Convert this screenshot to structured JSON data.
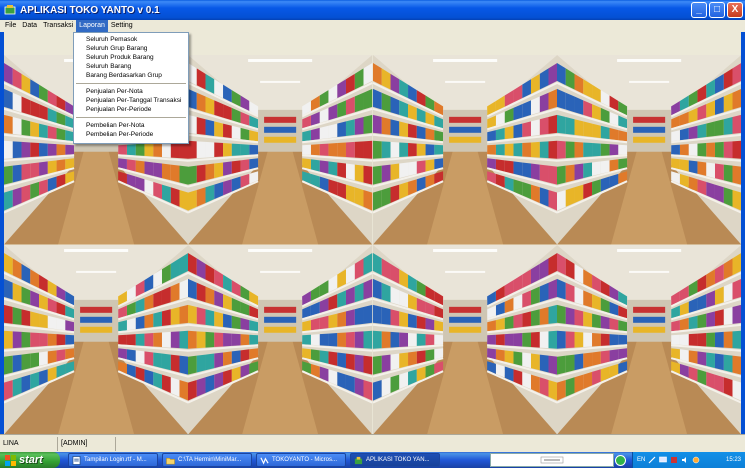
{
  "window": {
    "title": "APLIKASI TOKO YANTO v 0.1",
    "buttons": {
      "minimize": "_",
      "maximize": "□",
      "close": "X"
    }
  },
  "menubar": {
    "items": [
      {
        "label": "File"
      },
      {
        "label": "Data"
      },
      {
        "label": "Transaksi"
      },
      {
        "label": "Laporan"
      },
      {
        "label": "Setting"
      }
    ],
    "active": "Laporan"
  },
  "dropdown": {
    "groups": [
      [
        "Seluruh Pemasok",
        "Seluruh Grup Barang",
        "Seluruh Produk Barang",
        "Seluruh Barang",
        "Barang Berdasarkan Grup"
      ],
      [
        "Penjualan Per-Nota",
        "Penjualan Per-Tanggal Transaksi",
        "Penjualan Per-Periode"
      ],
      [
        "Pembelian Per-Nota",
        "Pembelian Per-Periode"
      ]
    ]
  },
  "statusbar": {
    "user": "LINA",
    "role": "[ADMIN]"
  },
  "taskbar": {
    "start_label": "start",
    "tasks": [
      {
        "label": "Tampilan Login.rtf - M..."
      },
      {
        "label": "C:\\TA Hermin\\MiniMar..."
      },
      {
        "label": "TOKOYANTO - Micros..."
      },
      {
        "label": "APLIKASI TOKO YAN..."
      }
    ],
    "tray": {
      "language": "EN",
      "time": "15:23"
    }
  },
  "colors": {
    "titlebar": "#0450d4",
    "menu_active": "#316ac5",
    "taskbar": "#2157d7",
    "start": "#33a133"
  }
}
